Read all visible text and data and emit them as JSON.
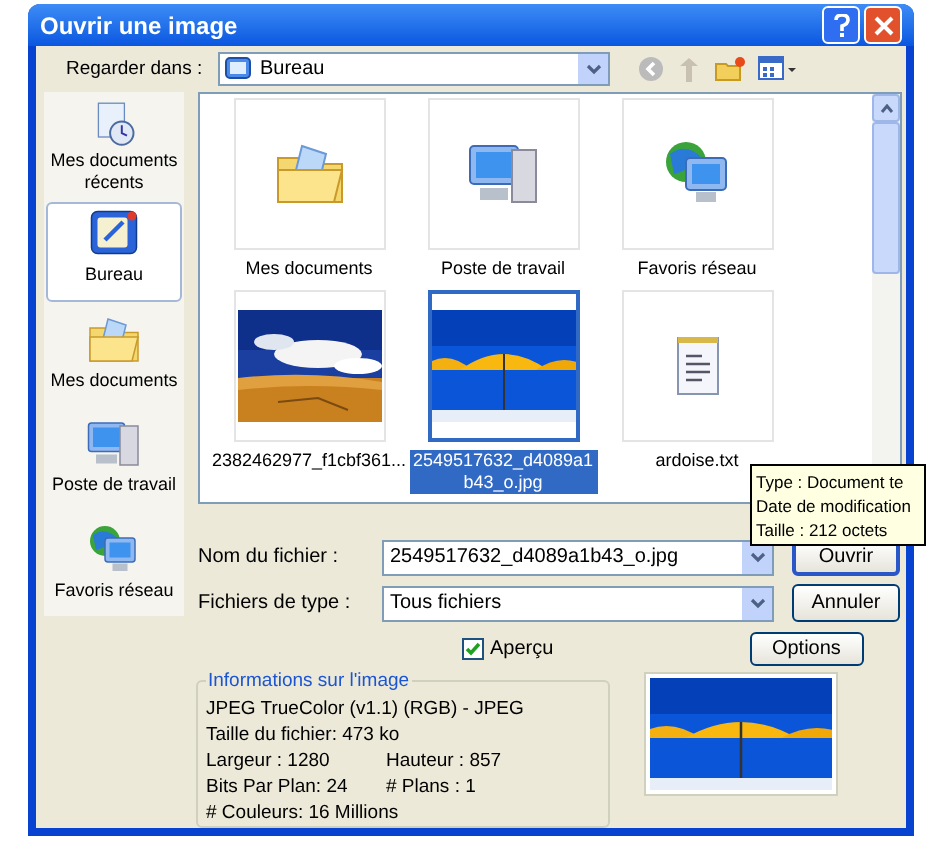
{
  "window": {
    "title": "Ouvrir une image"
  },
  "look_in": {
    "label": "Regarder dans :",
    "value": "Bureau"
  },
  "places": [
    {
      "label": "Mes documents récents",
      "kind": "recent",
      "selected": false
    },
    {
      "label": "Bureau",
      "kind": "desktop",
      "selected": true
    },
    {
      "label": "Mes documents",
      "kind": "folder",
      "selected": false
    },
    {
      "label": "Poste de travail",
      "kind": "computer",
      "selected": false
    },
    {
      "label": "Favoris réseau",
      "kind": "network",
      "selected": false
    }
  ],
  "files": [
    {
      "name": "Mes documents",
      "kind": "folder",
      "selected": false
    },
    {
      "name": "Poste de travail",
      "kind": "computer",
      "selected": false
    },
    {
      "name": "Favoris réseau",
      "kind": "network",
      "selected": false
    },
    {
      "name": "2382462977_f1cbf361...",
      "kind": "desert",
      "selected": false
    },
    {
      "name": "2549517632_d4089a1b43_o.jpg",
      "kind": "umbrella",
      "selected": true
    },
    {
      "name": "ardoise.txt",
      "kind": "text",
      "selected": false
    }
  ],
  "tooltip": [
    "Type : Document te",
    "Date de modification",
    "Taille : 212 octets"
  ],
  "file_name": {
    "label": "Nom du fichier :",
    "value": "2549517632_d4089a1b43_o.jpg"
  },
  "file_type": {
    "label": "Fichiers de type :",
    "value": "Tous fichiers"
  },
  "buttons": [
    {
      "label": "Ouvrir",
      "default": true
    },
    {
      "label": "Annuler",
      "default": false
    }
  ],
  "preview": {
    "label": "Aperçu",
    "checked": true
  },
  "options_button": "Options",
  "info": {
    "title": "Informations sur l'image",
    "rows": [
      [
        "JPEG TrueColor (v1.1) (RGB) - JPEG"
      ],
      [
        "Taille du fichier: 473 ko"
      ],
      [
        "Largeur : 1280",
        "Hauteur : 857"
      ],
      [
        "Bits Par Plan: 24",
        "# Plans : 1"
      ],
      [
        "# Couleurs: 16 Millions"
      ]
    ]
  }
}
